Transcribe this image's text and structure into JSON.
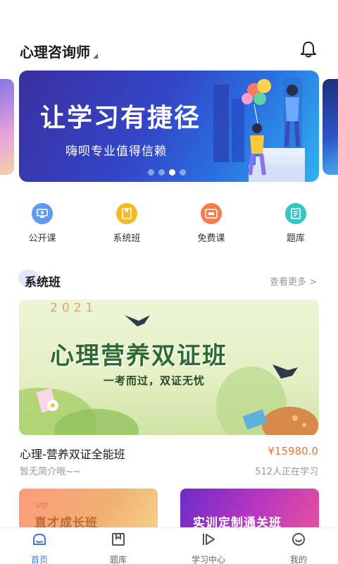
{
  "header": {
    "title": "心理咨询师"
  },
  "banner": {
    "headline": "让学习有捷径",
    "subline": "嗨呗专业值得信赖",
    "dots_count": 4,
    "active_dot": 3
  },
  "quick_links": [
    {
      "label": "公开课",
      "icon": "screen-icon",
      "color": "#5c9cf0"
    },
    {
      "label": "系统班",
      "icon": "book-icon",
      "color": "#f3bb24"
    },
    {
      "label": "免费课",
      "icon": "free-tag-icon",
      "color": "#f47e4d"
    },
    {
      "label": "题库",
      "icon": "document-icon",
      "color": "#35c6c2"
    }
  ],
  "section": {
    "title": "系统班",
    "more": "查看更多 >"
  },
  "course": {
    "image_year": "2021",
    "image_title": "心理营养双证班",
    "image_subtitle": "一考而过，双证无忧",
    "name": "心理-营养双证全能班",
    "price": "¥15980.0",
    "description": "暂无简介哦~~",
    "learners": "512人正在学习"
  },
  "mini_cards": [
    {
      "tag": "VIP",
      "title": "直才成长班"
    },
    {
      "title": "实训定制通关班"
    }
  ],
  "tabbar": [
    {
      "label": "首页",
      "icon": "home-icon",
      "active": true
    },
    {
      "label": "题库",
      "icon": "question-bank-icon",
      "active": false
    },
    {
      "label": "学习中心",
      "icon": "play-icon",
      "active": false
    },
    {
      "label": "我的",
      "icon": "profile-icon",
      "active": false
    }
  ],
  "colors": {
    "accent": "#3b76f0",
    "price": "#e2783c"
  }
}
